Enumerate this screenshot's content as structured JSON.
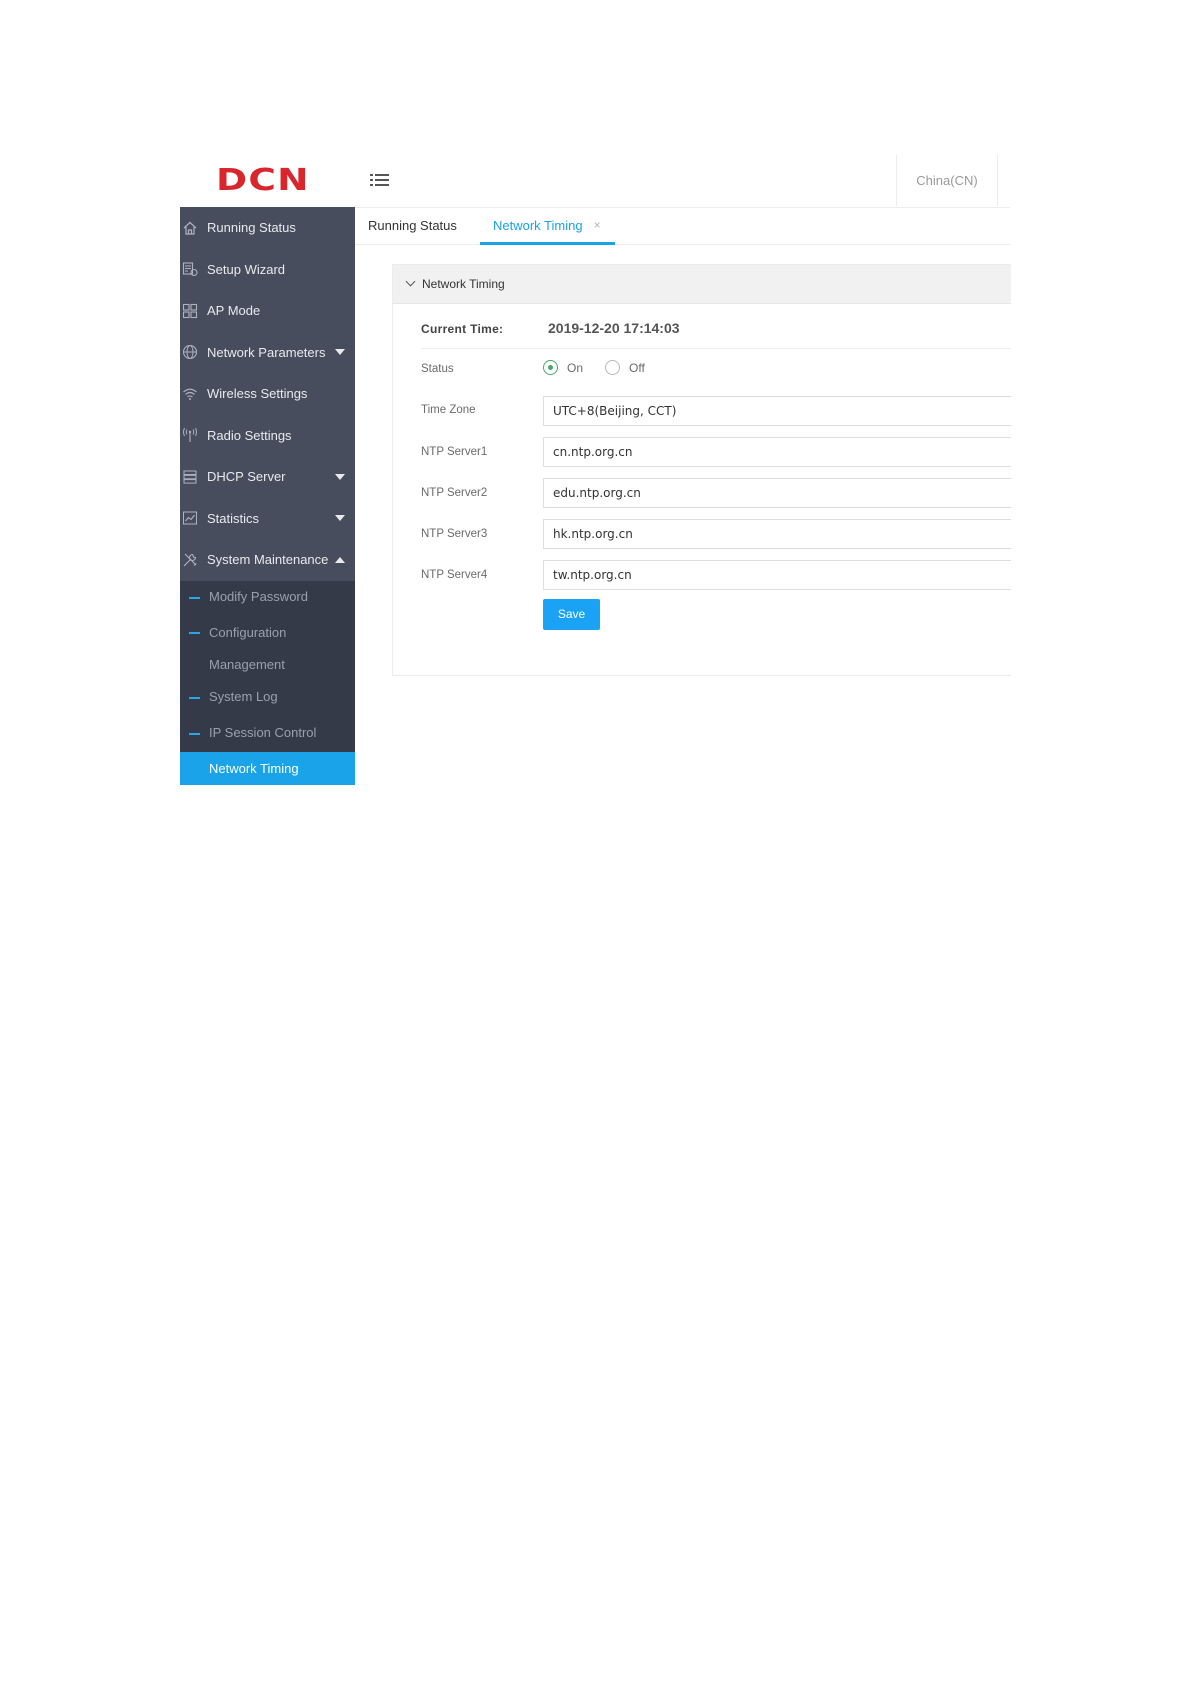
{
  "header": {
    "logo": "DCN",
    "language": "China(CN)"
  },
  "sidebar": {
    "items": [
      {
        "label": "Running Status",
        "icon": "home-icon"
      },
      {
        "label": "Setup Wizard",
        "icon": "wizard-icon"
      },
      {
        "label": "AP Mode",
        "icon": "grid-icon"
      },
      {
        "label": "Network Parameters",
        "icon": "globe-icon"
      },
      {
        "label": "Wireless Settings",
        "icon": "wifi-icon"
      },
      {
        "label": "Radio Settings",
        "icon": "antenna-icon"
      },
      {
        "label": "DHCP Server",
        "icon": "server-icon"
      },
      {
        "label": "Statistics",
        "icon": "chart-icon"
      },
      {
        "label": "System Maintenance",
        "icon": "tools-icon"
      }
    ],
    "submenu": [
      {
        "label": "Modify Password"
      },
      {
        "label": "Configuration"
      },
      {
        "label": "Management"
      },
      {
        "label": "System Log"
      },
      {
        "label": "IP Session Control"
      },
      {
        "label": "Network Timing"
      }
    ]
  },
  "tabs": [
    {
      "label": "Running Status"
    },
    {
      "label": "Network Timing",
      "close": "×"
    }
  ],
  "panel": {
    "title": "Network Timing",
    "current_time_label": "Current Time:",
    "current_time_value": "2019-12-20 17:14:03",
    "status_label": "Status",
    "status_on": "On",
    "status_off": "Off",
    "status_selected": "On",
    "time_zone_label": "Time Zone",
    "time_zone_value": "UTC+8(Beijing, CCT)",
    "ntp1_label": "NTP Server1",
    "ntp1_value": "cn.ntp.org.cn",
    "ntp2_label": "NTP Server2",
    "ntp2_value": "edu.ntp.org.cn",
    "ntp3_label": "NTP Server3",
    "ntp3_value": "hk.ntp.org.cn",
    "ntp4_label": "NTP Server4",
    "ntp4_value": "tw.ntp.org.cn",
    "save_label": "Save"
  },
  "colors": {
    "brand": "#d9262c",
    "accent": "#1aa3e8",
    "sidebar_bg": "#474d5c",
    "submenu_bg": "#343a48",
    "radio_on": "#4aa76a"
  }
}
